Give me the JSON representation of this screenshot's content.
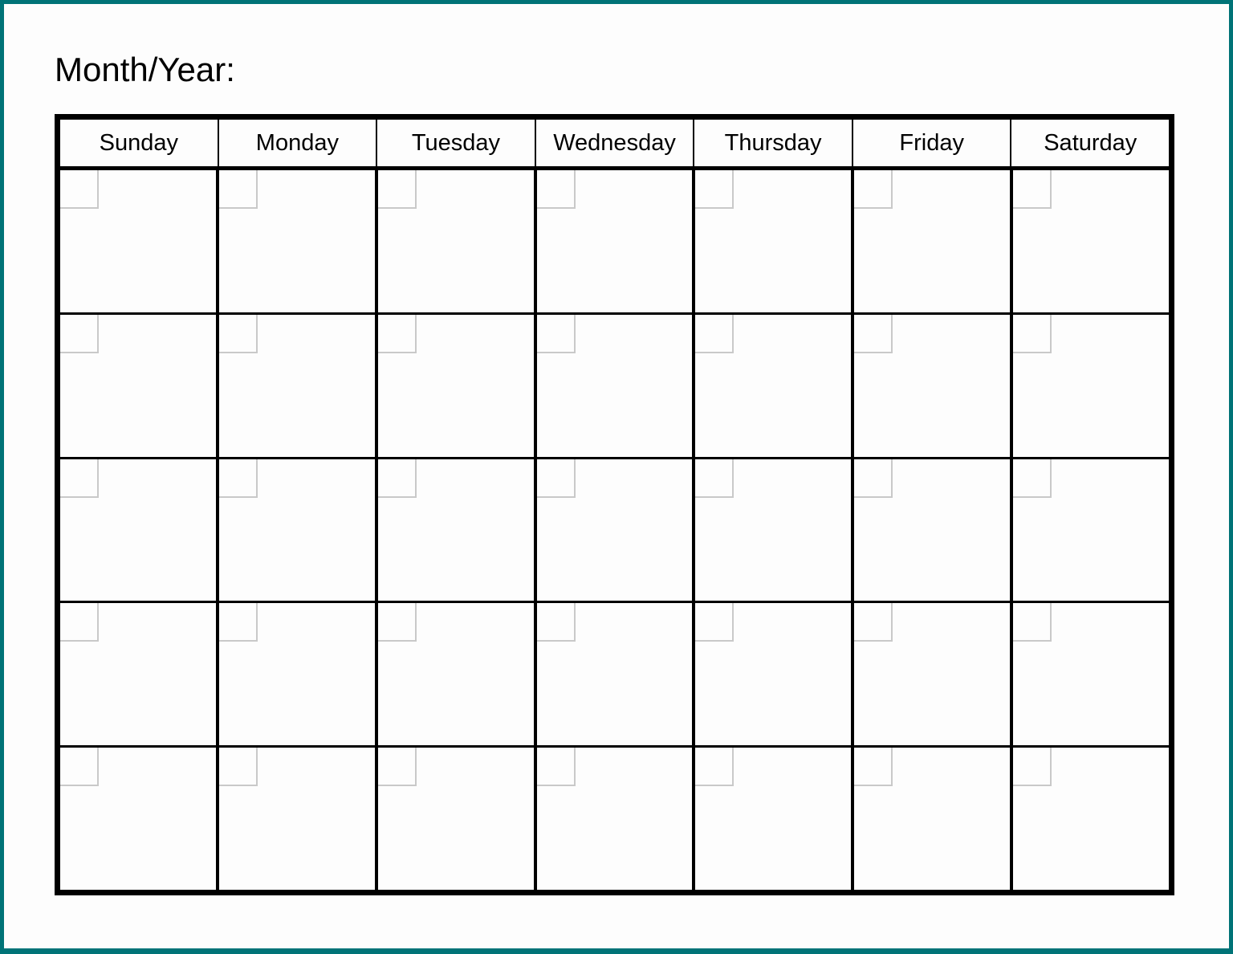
{
  "page": {
    "border_color": "#007377",
    "background_color": "#fdfdfd",
    "grid_line_color": "#000000",
    "date_box_border_color": "#c9c9c9"
  },
  "title": "Month/Year:",
  "calendar": {
    "weekday_headers": [
      "Sunday",
      "Monday",
      "Tuesday",
      "Wednesday",
      "Thursday",
      "Friday",
      "Saturday"
    ],
    "weeks": [
      {
        "days": [
          "",
          "",
          "",
          "",
          "",
          "",
          ""
        ]
      },
      {
        "days": [
          "",
          "",
          "",
          "",
          "",
          "",
          ""
        ]
      },
      {
        "days": [
          "",
          "",
          "",
          "",
          "",
          "",
          ""
        ]
      },
      {
        "days": [
          "",
          "",
          "",
          "",
          "",
          "",
          ""
        ]
      },
      {
        "days": [
          "",
          "",
          "",
          "",
          "",
          "",
          ""
        ]
      }
    ]
  }
}
